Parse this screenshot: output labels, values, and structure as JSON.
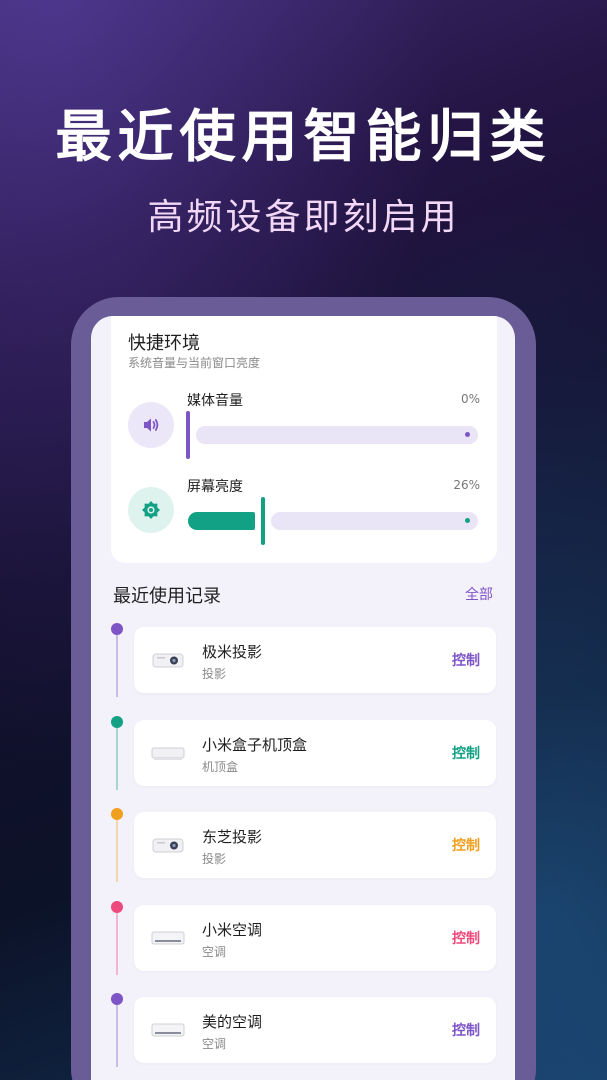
{
  "headline": "最近使用智能归类",
  "subheadline": "高频设备即刻启用",
  "quick": {
    "title": "快捷环境",
    "subtitle": "系统音量与当前窗口亮度",
    "media": {
      "label": "媒体音量",
      "value": "0%",
      "level": 0,
      "icon": "speaker-icon",
      "color": "#7e55c6"
    },
    "brightness": {
      "label": "屏幕亮度",
      "value": "26%",
      "level": 0.26,
      "icon": "sun-icon",
      "color": "#12a184"
    }
  },
  "recent": {
    "title": "最近使用记录",
    "all_label": "全部",
    "items": [
      {
        "name": "极米投影",
        "type": "投影",
        "control": "控制",
        "color": "#7e55c6",
        "icon": "projector-icon"
      },
      {
        "name": "小米盒子机顶盒",
        "type": "机顶盒",
        "control": "控制",
        "color": "#12a184",
        "icon": "settop-box-icon"
      },
      {
        "name": "东芝投影",
        "type": "投影",
        "control": "控制",
        "color": "#f0a01e",
        "icon": "projector-icon"
      },
      {
        "name": "小米空调",
        "type": "空调",
        "control": "控制",
        "color": "#ee4a7e",
        "icon": "air-conditioner-icon"
      },
      {
        "name": "美的空调",
        "type": "空调",
        "control": "控制",
        "color": "#7e55c6",
        "icon": "air-conditioner-icon"
      }
    ]
  }
}
